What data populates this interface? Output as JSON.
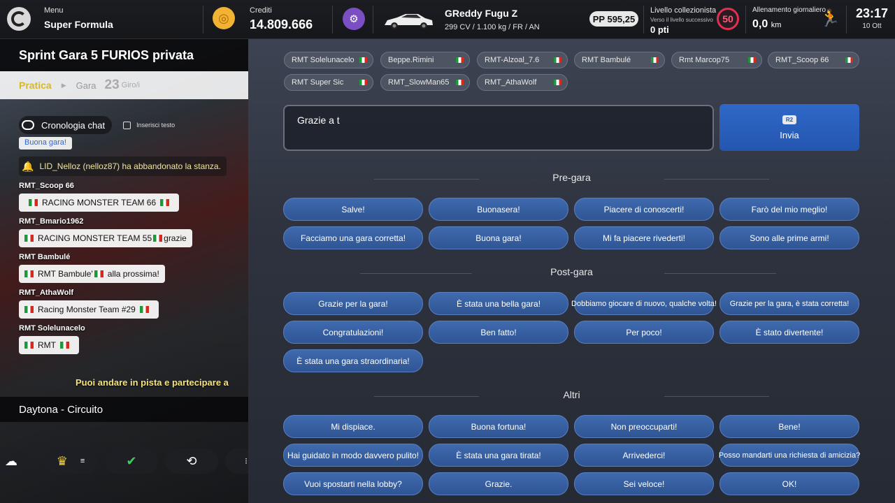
{
  "topbar": {
    "menu_label": "Menu",
    "menu_value": "Super Formula",
    "credits_label": "Crediti",
    "credits_value": "14.809.666",
    "car_name": "GReddy Fugu Z",
    "car_specs": "299 CV / 1.100 kg / FR / AN",
    "pp": "PP 595,25",
    "collector_label": "Livello collezionista",
    "collector_next": "Verso il livello successivo",
    "collector_points": "0 pti",
    "collector_level": "50",
    "training_label": "Allenamento giornaliero",
    "training_value": "0,0",
    "training_unit": "km",
    "time": "23:17",
    "date": "10 Ott"
  },
  "left": {
    "room_title": "Sprint Gara 5 FURIOS privata",
    "session_pratica": "Pratica",
    "session_gara": "Gara",
    "session_laps": "23",
    "session_laps_unit": "Giro/i",
    "chat_history": "Cronologia chat",
    "insert_text": "Inserisci testo",
    "first_msg": "Buona gara!",
    "system_msg": "LID_Nelloz (nelloz87) ha abbandonato la stanza.",
    "messages": [
      {
        "author": "RMT_Scoop 66",
        "pre": "RACING MONSTER TEAM 66",
        "post": ""
      },
      {
        "author": "RMT_Bmario1962",
        "pre": "RACING MONSTER TEAM 55",
        "post": "grazie"
      },
      {
        "author": "RMT Bambulé",
        "pre": "RMT  Bambule'",
        "post": "alla prossima!"
      },
      {
        "author": "RMT_AthaWolf",
        "pre": "Racing Monster Team #29",
        "post": ""
      },
      {
        "author": "RMT Solelunacelo",
        "pre": "RMT",
        "post": ""
      }
    ],
    "marquee": "Puoi andare in pista e partecipare a",
    "track": "Daytona - Circuito"
  },
  "recipients": [
    "RMT Solelunacelo",
    "Beppe.Rimini",
    "RMT-Alzoal_7.6",
    "RMT Bambulé",
    "Rmt Marcop75",
    "RMT_Scoop 66",
    "RMT Super Sic",
    "RMT_SlowMan65",
    "RMT_AthaWolf"
  ],
  "input": {
    "value": "Grazie a t",
    "send_key": "R2",
    "send_label": "Invia"
  },
  "sections": {
    "pre": {
      "title": "Pre-gara",
      "phrases": [
        "Salve!",
        "Buonasera!",
        "Piacere di conoscerti!",
        "Farò del mio meglio!",
        "Facciamo una gara corretta!",
        "Buona gara!",
        "Mi fa piacere rivederti!",
        "Sono alle prime armi!"
      ]
    },
    "post": {
      "title": "Post-gara",
      "phrases": [
        "Grazie per la gara!",
        "È stata una bella gara!",
        "Dobbiamo giocare di nuovo, qualche volta!",
        "Grazie per la gara, è stata corretta!",
        "Congratulazioni!",
        "Ben fatto!",
        "Per poco!",
        "È stato divertente!",
        "È stata una gara straordinaria!"
      ]
    },
    "other": {
      "title": "Altri",
      "phrases": [
        "Mi dispiace.",
        "Buona fortuna!",
        "Non preoccuparti!",
        "Bene!",
        "Hai guidato in modo davvero pulito!",
        "È stata una gara tirata!",
        "Arrivederci!",
        "Posso mandarti una richiesta di amicizia?",
        "Vuoi spostarti nella lobby?",
        "Grazie.",
        "Sei veloce!",
        "OK!"
      ]
    }
  }
}
